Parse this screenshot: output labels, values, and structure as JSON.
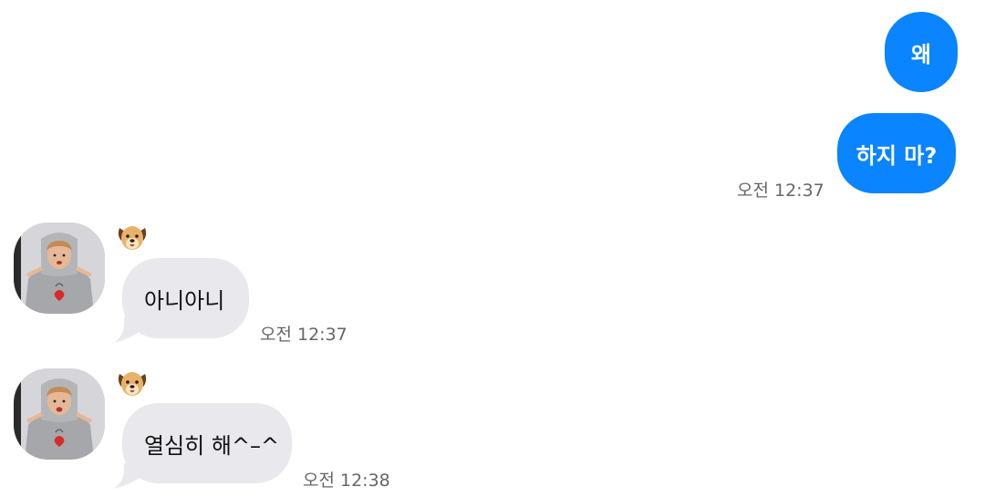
{
  "messages": {
    "outgoing": [
      {
        "text": "왜"
      },
      {
        "text": "하지 마?"
      }
    ],
    "outgoing_time": "오전 12:37",
    "incoming": [
      {
        "sender_icon": "dog-face-icon",
        "text": "아니아니",
        "time": "오전 12:37"
      },
      {
        "sender_icon": "dog-face-icon",
        "text": "열심히 해^–^",
        "time": "오전 12:38"
      }
    ]
  },
  "colors": {
    "outgoing_bubble": "#0a84ff",
    "incoming_bubble": "#e8e8ed",
    "timestamp": "#666666"
  }
}
